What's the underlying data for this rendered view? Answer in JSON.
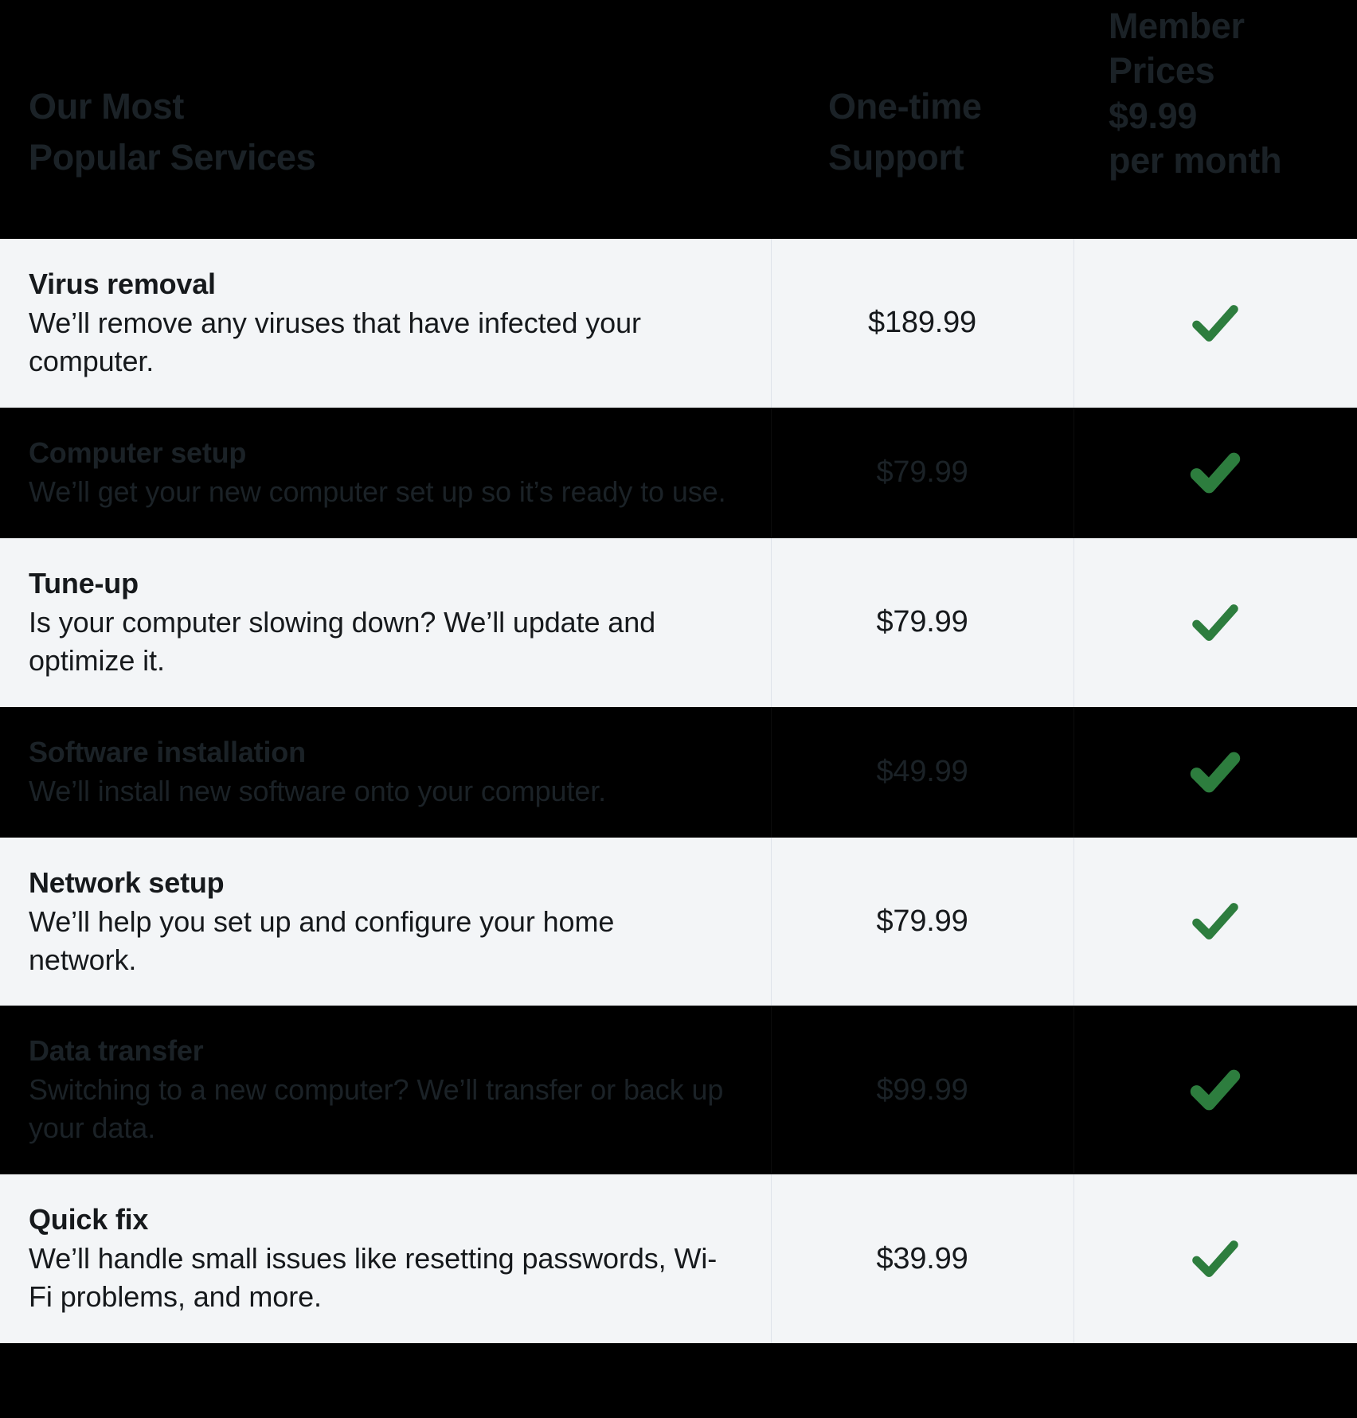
{
  "header": {
    "services_title": "Our Most\nPopular Services",
    "onetime_title": "One-time\nSupport",
    "member_title": "Member\nPrices",
    "member_price": "$9.99\nper month"
  },
  "colors": {
    "header_bg": "#000000",
    "row_light_bg": "#f3f5f7",
    "row_dark_bg": "#000000",
    "header_text": "#1b2227",
    "body_text": "#16191c",
    "check_green": "#2d7d3e",
    "divider": "#dfe3ea"
  },
  "icons": {
    "check": "check-icon"
  },
  "rows": [
    {
      "name": "Virus removal",
      "description": "We’ll remove any viruses that have infected your computer.",
      "price": "$189.99",
      "included": true,
      "theme": "light"
    },
    {
      "name": "Computer setup",
      "description": "We’ll get your new computer set up so it’s ready to use.",
      "price": "$79.99",
      "included": true,
      "theme": "dark"
    },
    {
      "name": "Tune-up",
      "description": "Is your computer slowing down? We’ll update and optimize it.",
      "price": "$79.99",
      "included": true,
      "theme": "light"
    },
    {
      "name": "Software installation",
      "description": "We’ll install new software onto your computer.",
      "price": "$49.99",
      "included": true,
      "theme": "dark"
    },
    {
      "name": "Network setup",
      "description": "We’ll help you set up and configure your home network.",
      "price": "$79.99",
      "included": true,
      "theme": "light"
    },
    {
      "name": "Data transfer",
      "description": "Switching to a new computer? We’ll transfer or back up your data.",
      "price": "$99.99",
      "included": true,
      "theme": "dark"
    },
    {
      "name": "Quick fix",
      "description": "We’ll handle small issues like resetting passwords, Wi-Fi problems, and more.",
      "price": "$39.99",
      "included": true,
      "theme": "light"
    }
  ]
}
